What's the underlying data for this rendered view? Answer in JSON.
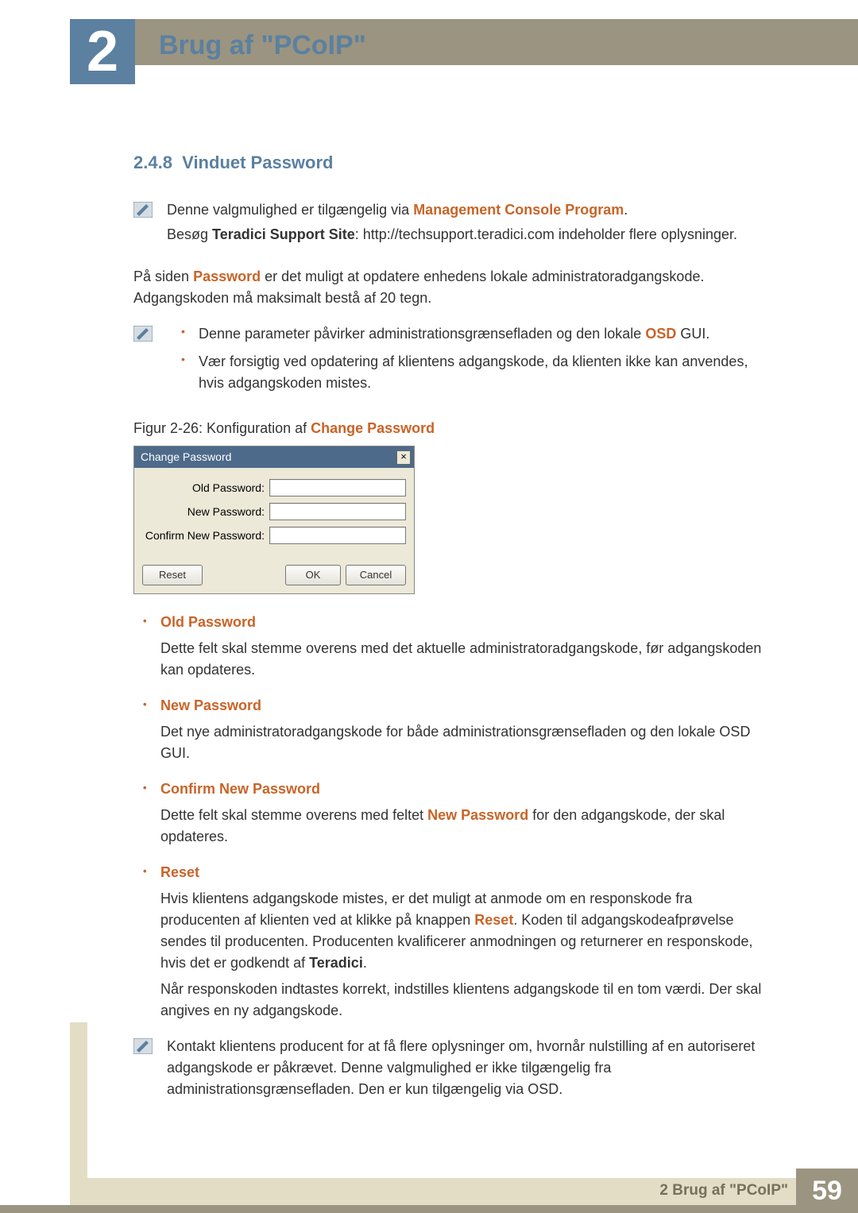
{
  "chapter": {
    "number": "2",
    "title": "Brug af \"PCoIP\""
  },
  "section": {
    "number": "2.4.8",
    "title": "Vinduet Password"
  },
  "note1": {
    "line1_a": "Denne valgmulighed er tilgængelig via ",
    "line1_b": "Management Console Program",
    "line1_c": ".",
    "line2_a": "Besøg ",
    "line2_b": "Teradici Support Site",
    "line2_c": ": http://techsupport.teradici.com indeholder flere oplysninger."
  },
  "intro": {
    "p1_a": "På siden ",
    "p1_b": "Password",
    "p1_c": " er det muligt at opdatere enhedens lokale administratoradgangskode. Adgangskoden må maksimalt bestå af 20 tegn."
  },
  "note2": {
    "b1_a": "Denne parameter påvirker administrationsgrænsefladen og den lokale ",
    "b1_b": "OSD",
    "b1_c": " GUI.",
    "b2": "Vær forsigtig ved opdatering af klientens adgangskode, da klienten ikke kan anvendes, hvis adgangskoden mistes."
  },
  "figure": {
    "a": "Figur 2-26: Konfiguration af ",
    "b": "Change Password"
  },
  "dialog": {
    "title": "Change Password",
    "close": "×",
    "labels": {
      "old": "Old Password:",
      "new": "New Password:",
      "confirm": "Confirm New Password:"
    },
    "buttons": {
      "reset": "Reset",
      "ok": "OK",
      "cancel": "Cancel"
    }
  },
  "fields": {
    "old": {
      "title": "Old Password",
      "desc": "Dette felt skal stemme overens med det aktuelle administratoradgangskode, før adgangskoden kan opdateres."
    },
    "new": {
      "title": "New Password",
      "desc": "Det nye administratoradgangskode for både administrationsgrænsefladen og den lokale OSD GUI."
    },
    "confirm": {
      "title": "Confirm New Password",
      "desc_a": "Dette felt skal stemme overens med feltet ",
      "desc_b": "New Password",
      "desc_c": " for den adgangskode, der skal opdateres."
    },
    "reset": {
      "title": "Reset",
      "p1_a": "Hvis klientens adgangskode mistes, er det muligt at anmode om en responskode fra producenten af klienten ved at klikke på knappen ",
      "p1_b": "Reset",
      "p1_c": ". Koden til adgangskodeafprøvelse sendes til producenten. Producenten kvalificerer anmodningen og returnerer en responskode, hvis det er godkendt af ",
      "p1_d": "Teradici",
      "p1_e": ".",
      "p2": "Når responskoden indtastes korrekt, indstilles klientens adgangskode til en tom værdi. Der skal angives en ny adgangskode."
    }
  },
  "note3": {
    "text": "Kontakt klientens producent for at få flere oplysninger om, hvornår nulstilling af en autoriseret adgangskode er påkrævet. Denne valgmulighed er ikke tilgængelig fra administrationsgrænsefladen. Den er kun tilgængelig via OSD."
  },
  "footer": {
    "text": "2 Brug af \"PCoIP\"",
    "page": "59"
  }
}
